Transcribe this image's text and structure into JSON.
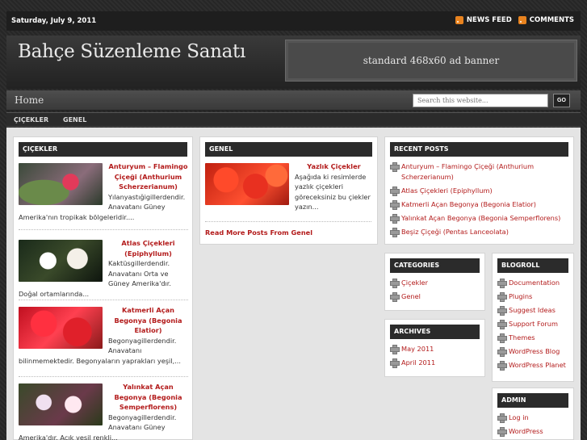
{
  "topbar": {
    "date": "Saturday, July 9, 2011",
    "news_feed": "NEWS FEED",
    "comments": "COMMENTS"
  },
  "header": {
    "site_title": "Bahçe Süzenleme Sanatı",
    "ad_banner": "standard 468x60 ad banner"
  },
  "nav": {
    "home": "Home",
    "search_placeholder": "Search this website...",
    "search_button": "GO"
  },
  "categories_bar": [
    "ÇIÇEKLER",
    "GENEL"
  ],
  "col1": {
    "title": "ÇIÇEKLER",
    "posts": [
      {
        "title": "Anturyum – Flamingo Çiçeği (Anthurium Scherzerianum)",
        "excerpt": "Yılanyastığigillerdendir. Anavatanı Güney Amerika'nın tropikak bölgeleridir...."
      },
      {
        "title": "Atlas Çiçekleri (Epiphyllum)",
        "excerpt": "Kaktüsgillerdendir. Anavatanı Orta ve Güney Amerika'dır. Doğal ortamlarında..."
      },
      {
        "title": "Katmerli Açan Begonya (Begonia Elatior)",
        "excerpt": "Begonyagillerdendir. Anavatanı bilinmemektedir. Begonyaların yaprakları yeşil,..."
      },
      {
        "title": "Yalınkat Açan Begonya (Begonia Semperflorens)",
        "excerpt": "Begonyagillerdendir. Anavatanı Güney Amerika'dır. Açık yeşil renkli..."
      }
    ]
  },
  "col2": {
    "title": "GENEL",
    "post": {
      "title": "Yazlık Çiçekler",
      "excerpt": "Aşağıda ki resimlerde yazlık çiçekleri göreceksiniz bu çiekler yazın..."
    },
    "read_more": "Read More Posts From Genel"
  },
  "recent_posts": {
    "title": "RECENT POSTS",
    "items": [
      "Anturyum – Flamingo Çiçeği (Anthurium Scherzerianum)",
      "Atlas Çiçekleri (Epiphyllum)",
      "Katmerli Açan Begonya (Begonia Elatior)",
      "Yalınkat Açan Begonya (Begonia Semperflorens)",
      "Beşiz Çiçeği (Pentas Lanceolata)"
    ]
  },
  "categories_widget": {
    "title": "CATEGORIES",
    "items": [
      "Çiçekler",
      "Genel"
    ]
  },
  "archives": {
    "title": "ARCHIVES",
    "items": [
      "May 2011",
      "April 2011"
    ]
  },
  "blogroll": {
    "title": "BLOGROLL",
    "items": [
      "Documentation",
      "Plugins",
      "Suggest Ideas",
      "Support Forum",
      "Themes",
      "WordPress Blog",
      "WordPress Planet"
    ]
  },
  "admin": {
    "title": "ADMIN",
    "items": [
      "Log in",
      "WordPress"
    ]
  },
  "colors": {
    "accent": "#b31b1b",
    "bar": "#2b2b2b",
    "rss": "#e8831f"
  },
  "icons": [
    "rss-icon",
    "plus-icon"
  ]
}
